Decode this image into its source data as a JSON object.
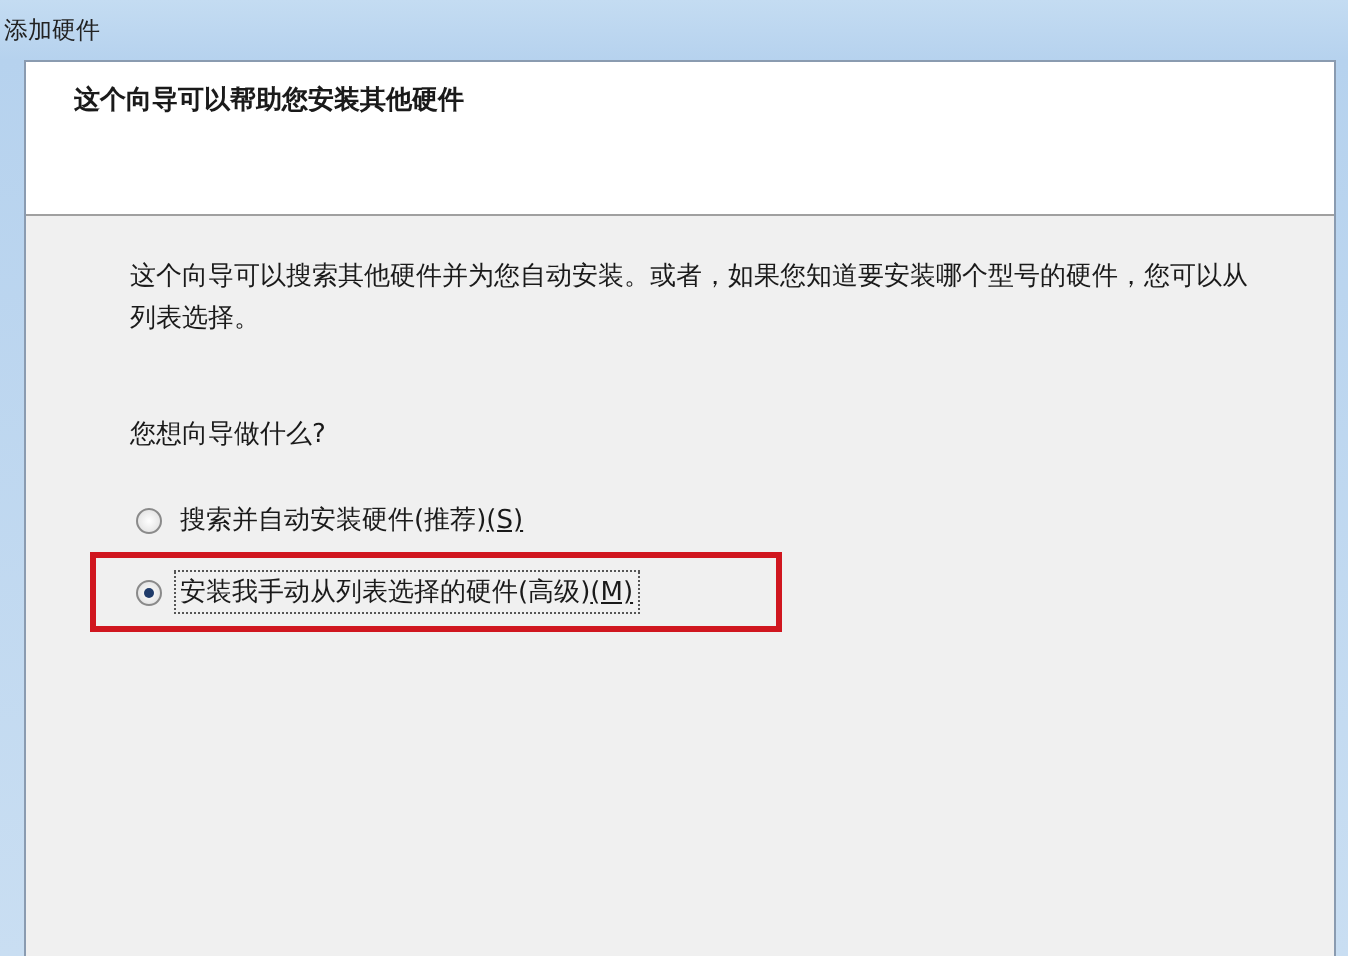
{
  "window": {
    "title": "添加硬件"
  },
  "header": {
    "title": "这个向导可以帮助您安装其他硬件"
  },
  "body": {
    "description": "这个向导可以搜索其他硬件并为您自动安装。或者，如果您知道要安装哪个型号的硬件，您可以从列表选择。",
    "question": "您想向导做什么?"
  },
  "options": [
    {
      "label": "搜索并自动安装硬件(推荐)",
      "mnemonic": "(S)",
      "selected": false,
      "highlighted": false
    },
    {
      "label": "安装我手动从列表选择的硬件(高级)",
      "mnemonic": "(M)",
      "selected": true,
      "highlighted": true
    }
  ]
}
